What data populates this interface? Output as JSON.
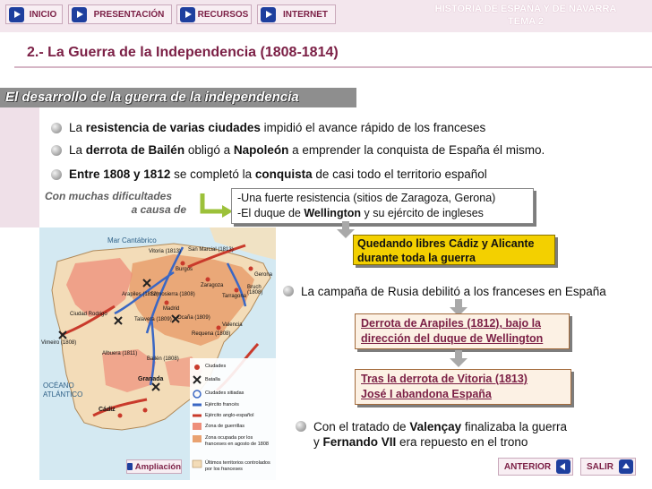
{
  "nav": {
    "inicio": "INICIO",
    "presentacion": "PRESENTACIÓN",
    "recursos": "RECURSOS",
    "internet": "INTERNET"
  },
  "header": {
    "line1": "HISTORIA DE ESPAÑA Y DE NAVARRA",
    "line2": "TEMA 2"
  },
  "section_title": "2.- La Guerra de la Independencia (1808-1814)",
  "subtitle": "El desarrollo de la guerra de la independencia",
  "bullets": {
    "b1": {
      "pre": "La ",
      "bold": "resistencia de varias ciudades",
      "post": " impidió el avance rápido de los franceses"
    },
    "b2": {
      "pre": "La ",
      "bold1": "derrota de Bailén",
      "mid": " obligó a ",
      "bold2": "Napoleón",
      "post": " a emprender la conquista de España él mismo."
    },
    "b3": {
      "bold": "Entre 1808 y 1812",
      "mid": " se completó la ",
      "bold2": "conquista",
      "post": " de casi todo el territorio español"
    }
  },
  "difficulties": {
    "line1": "Con muchas dificultades",
    "line2": "a causa de"
  },
  "causes": {
    "line1": "-Una fuerte resistencia (sitios de Zaragoza, Gerona)",
    "line2_pre": "-El duque de ",
    "line2_bold": "Wellington",
    "line2_post": " y su ejército de ingleses"
  },
  "cadiz_box": {
    "line1": "Quedando libres Cádiz y Alicante",
    "line2": "durante toda la guerra"
  },
  "russia_text": "La campaña de Rusia debilitó a los franceses en España",
  "arapiles_box": {
    "line1": "Derrota de Arapiles (1812), bajo la",
    "line2": "dirección del duque de Wellington"
  },
  "vitoria_box": {
    "line1": "Tras la derrota de Vitoria (1813)",
    "line2": "José I abandona España"
  },
  "valencay": {
    "line1_pre": "Con el tratado de ",
    "line1_bold": "Valençay",
    "line1_post": " finalizaba la guerra",
    "line2_pre": "y ",
    "line2_bold": "Fernando VII",
    "line2_post": " era repuesto en el trono"
  },
  "map": {
    "sea_north": "Mar Cantábrico",
    "ocean": "OCÉANO",
    "ocean2": "ATLÁNTICO",
    "cities": [
      "Vitoria (1813)",
      "San Marcial (1813)",
      "Burgos",
      "Zaragoza",
      "Gerona",
      "Tarragona",
      "Bruch (1808)",
      "Arapiles (1812)",
      "Somosierra (1808)",
      "Madrid",
      "Talavera (1809)",
      "Ocaña (1809)",
      "Ciudad Rodrigo",
      "Vimeiro (1808)",
      "Albuera (1811)",
      "Requena (1808)",
      "Valencia",
      "Bailén (1808)",
      "Granada",
      "Cádiz"
    ],
    "legend": [
      "Ciudades",
      "Batalla",
      "Ciudades sitiadas",
      "Ejército francés",
      "Ejército anglo-español",
      "Zona de guerrillas",
      "Zona ocupada por los franceses en agosto de 1808",
      "Últimos territorios controlados por los franceses"
    ],
    "colors": {
      "sea": "#d4e9f2",
      "land": "#f3dcb8",
      "occupied": "#e9a271",
      "french_army": "#3a67c4",
      "allied_army": "#c93a2b"
    }
  },
  "footer": {
    "ampliacion": "Ampliación",
    "anterior": "ANTERIOR",
    "salir": "SALIR"
  }
}
